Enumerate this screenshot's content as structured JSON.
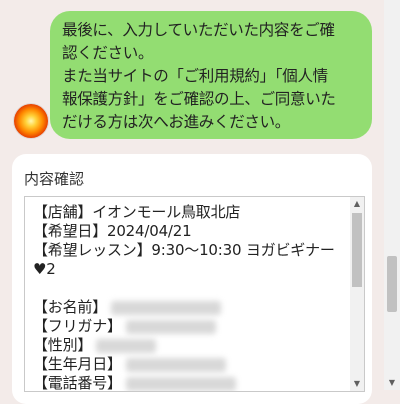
{
  "chat": {
    "message_lines": [
      "最後に、入力していただいた内容をご確",
      "認ください。",
      "また当サイトの「ご利用規約」「個人情",
      "報保護方針」をご確認の上、ご同意いた",
      "だける方は次へお進みください。"
    ]
  },
  "confirm": {
    "title": "内容確認",
    "lines": [
      "【店舗】イオンモール鳥取北店",
      "【希望日】2024/04/21",
      "【希望レッスン】9:30〜10:30 ヨガビギナー ♥2",
      "",
      "【お名前】",
      "【フリガナ】",
      "【性別】",
      "【生年月日】",
      "【電話番号】"
    ]
  },
  "icons": {
    "scroll_up": "▲",
    "scroll_down": "▼"
  }
}
